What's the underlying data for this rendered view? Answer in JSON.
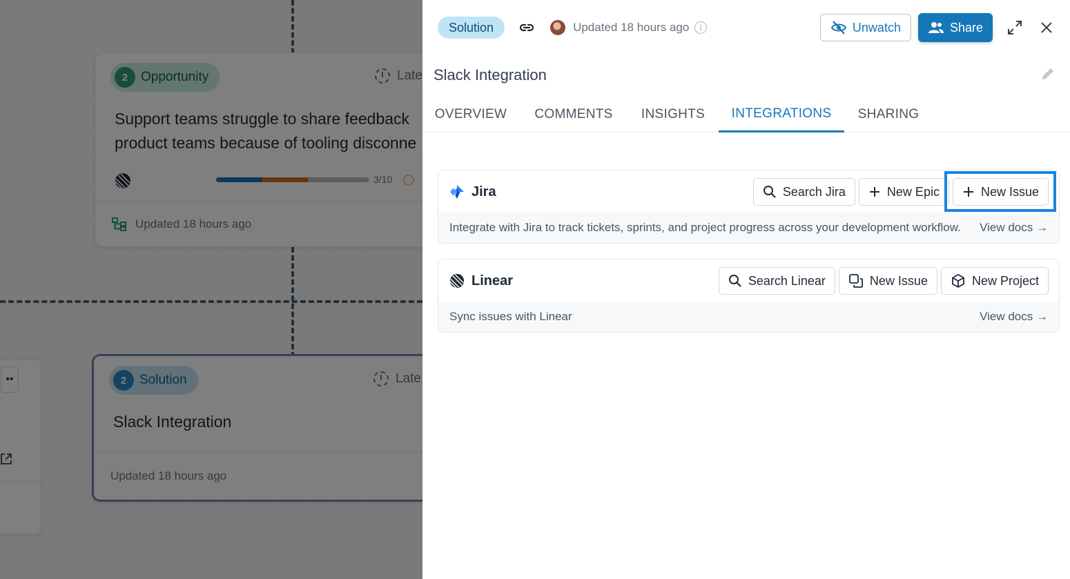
{
  "background": {
    "opportunity_card": {
      "badge_count": "2",
      "type_label": "Opportunity",
      "due_label": "Late",
      "text_line1": "Support teams struggle to share feedback",
      "text_line2": "product teams because of tooling disconne",
      "progress_label": "3/10",
      "progress_segments": [
        {
          "name": "blue",
          "fraction": 0.3,
          "color": "#1f6fb0"
        },
        {
          "name": "orange",
          "fraction": 0.3,
          "color": "#d36a1f"
        }
      ],
      "updated": "Updated 18 hours ago"
    },
    "solution_card": {
      "badge_count": "2",
      "type_label": "Solution",
      "due_label": "Late",
      "title": "Slack Integration",
      "updated": "Updated 18 hours ago"
    }
  },
  "drawer": {
    "type_pill": "Solution",
    "updated": "Updated 18 hours ago",
    "unwatch_label": "Unwatch",
    "share_label": "Share",
    "title": "Slack Integration",
    "tabs": [
      {
        "label": "OVERVIEW",
        "active": false
      },
      {
        "label": "COMMENTS",
        "active": false
      },
      {
        "label": "INSIGHTS",
        "active": false
      },
      {
        "label": "INTEGRATIONS",
        "active": true
      },
      {
        "label": "SHARING",
        "active": false
      }
    ],
    "integrations": {
      "jira": {
        "name": "Jira",
        "search_label": "Search Jira",
        "new_epic_label": "New Epic",
        "new_issue_label": "New Issue",
        "description": "Integrate with Jira to track tickets, sprints, and project progress across your development workflow.",
        "docs_label": "View docs →"
      },
      "linear": {
        "name": "Linear",
        "search_label": "Search Linear",
        "new_issue_label": "New Issue",
        "new_project_label": "New Project",
        "description": "Sync issues with Linear",
        "docs_label": "View docs →"
      }
    }
  },
  "colors": {
    "accent": "#1677b8",
    "pill_bg": "#bfe4f5",
    "highlight": "#1a84e0",
    "opportunity_badge": "#2f9c74",
    "solution_badge": "#2a86c4"
  }
}
